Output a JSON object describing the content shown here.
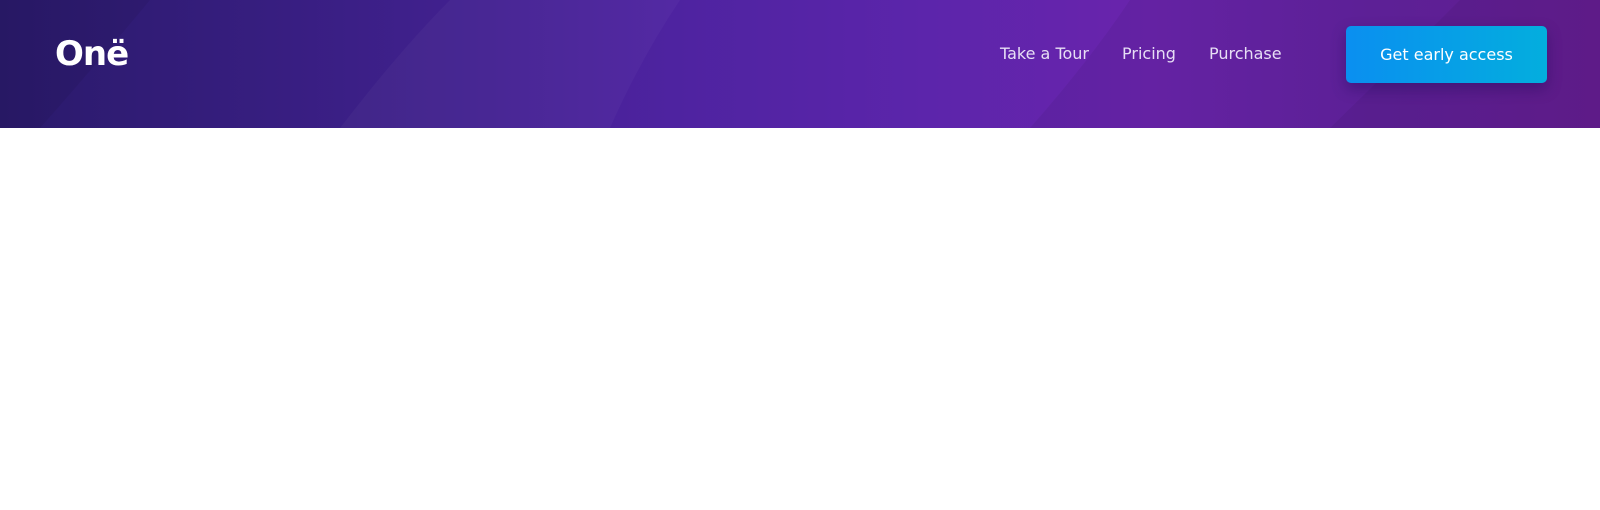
{
  "brand": {
    "logo_text": "Onë"
  },
  "nav": {
    "items": [
      {
        "label": "Take a Tour"
      },
      {
        "label": "Pricing"
      },
      {
        "label": "Purchase"
      }
    ],
    "cta_label": "Get early access"
  },
  "colors": {
    "header_start": "#2a1a6b",
    "header_mid": "#5c25ab",
    "header_end": "#6a1f98",
    "cta_start": "#0a8ff0",
    "cta_end": "#03aede",
    "page_background": "#ffffff"
  }
}
